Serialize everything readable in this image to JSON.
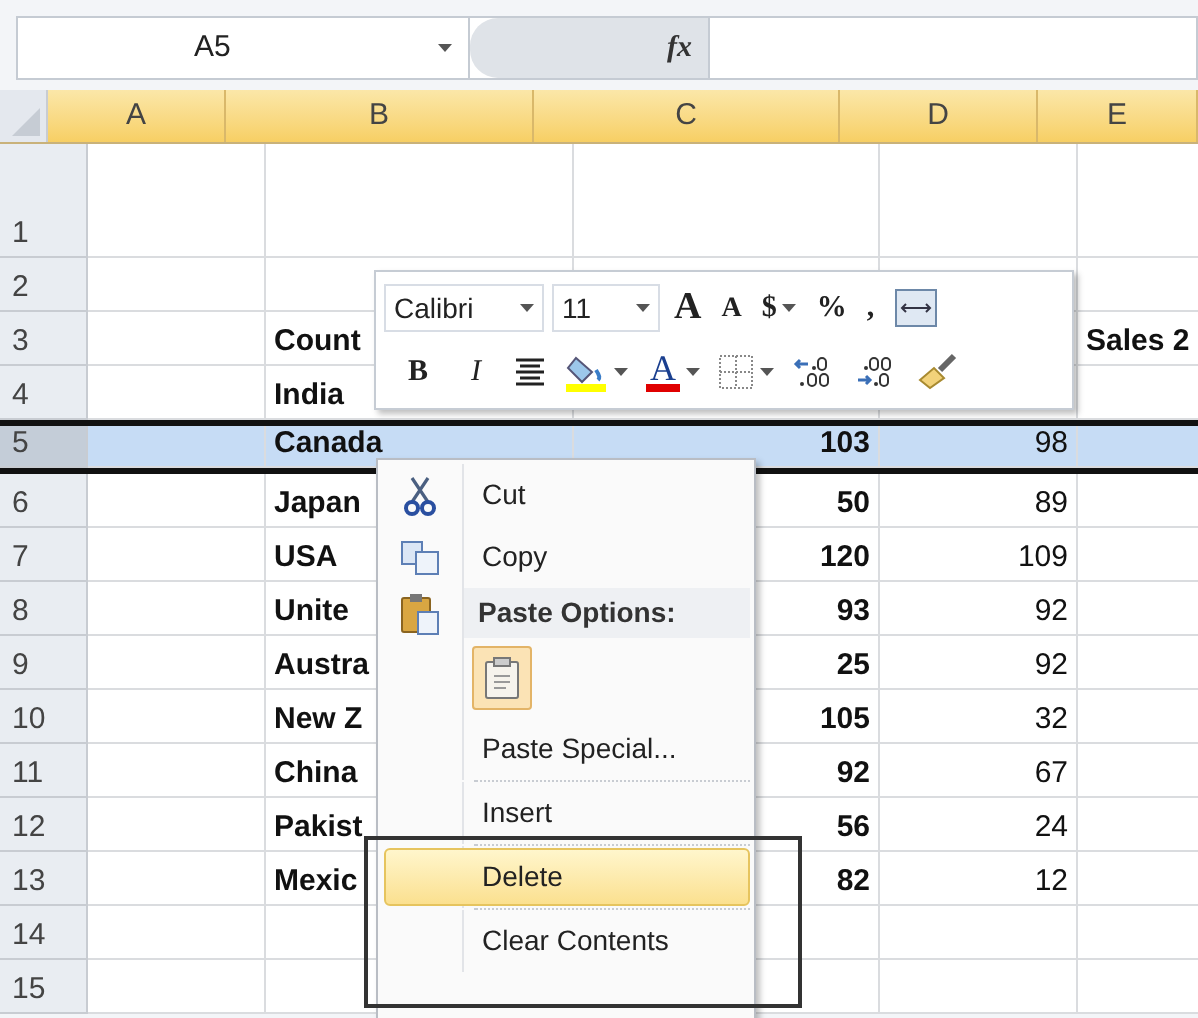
{
  "formula_bar": {
    "name_box": "A5",
    "function_label": "fx"
  },
  "columns": [
    {
      "label": "A"
    },
    {
      "label": "B"
    },
    {
      "label": "C"
    },
    {
      "label": "D"
    },
    {
      "label": "E"
    }
  ],
  "rows": [
    {
      "header": "1",
      "selected": false,
      "cells": {}
    },
    {
      "header": "2",
      "selected": false,
      "cells": {}
    },
    {
      "header": "3",
      "selected": false,
      "cells": {
        "B": {
          "text": "Count",
          "kind": "text"
        },
        "E": {
          "text": "Sales 2",
          "kind": "text"
        }
      }
    },
    {
      "header": "4",
      "selected": false,
      "cells": {
        "B": {
          "text": "India",
          "kind": "text"
        }
      }
    },
    {
      "header": "5",
      "selected": true,
      "cells": {
        "B": {
          "text": "Canada",
          "kind": "text"
        },
        "C": {
          "text": "103",
          "kind": "number"
        },
        "D": {
          "text": "98",
          "kind": "plain_number"
        }
      }
    },
    {
      "header": "6",
      "selected": false,
      "cells": {
        "B": {
          "text": "Japan",
          "kind": "text"
        },
        "C": {
          "text": "50",
          "kind": "number"
        },
        "D": {
          "text": "89",
          "kind": "plain_number"
        }
      }
    },
    {
      "header": "7",
      "selected": false,
      "cells": {
        "B": {
          "text": "USA",
          "kind": "text"
        },
        "C": {
          "text": "120",
          "kind": "number"
        },
        "D": {
          "text": "109",
          "kind": "plain_number"
        }
      }
    },
    {
      "header": "8",
      "selected": false,
      "cells": {
        "B": {
          "text": "Unite",
          "kind": "text"
        },
        "C": {
          "text": "93",
          "kind": "number"
        },
        "D": {
          "text": "92",
          "kind": "plain_number"
        }
      }
    },
    {
      "header": "9",
      "selected": false,
      "cells": {
        "B": {
          "text": "Austra",
          "kind": "text"
        },
        "C": {
          "text": "25",
          "kind": "number"
        },
        "D": {
          "text": "92",
          "kind": "plain_number"
        }
      }
    },
    {
      "header": "10",
      "selected": false,
      "cells": {
        "B": {
          "text": "New Z",
          "kind": "text"
        },
        "C": {
          "text": "105",
          "kind": "number"
        },
        "D": {
          "text": "32",
          "kind": "plain_number"
        }
      }
    },
    {
      "header": "11",
      "selected": false,
      "cells": {
        "B": {
          "text": "China",
          "kind": "text"
        },
        "C": {
          "text": "92",
          "kind": "number"
        },
        "D": {
          "text": "67",
          "kind": "plain_number"
        }
      }
    },
    {
      "header": "12",
      "selected": false,
      "cells": {
        "B": {
          "text": "Pakist",
          "kind": "text"
        },
        "C": {
          "text": "56",
          "kind": "number"
        },
        "D": {
          "text": "24",
          "kind": "plain_number"
        }
      }
    },
    {
      "header": "13",
      "selected": false,
      "cells": {
        "B": {
          "text": "Mexic",
          "kind": "text"
        },
        "C": {
          "text": "82",
          "kind": "number"
        },
        "D": {
          "text": "12",
          "kind": "plain_number"
        }
      }
    },
    {
      "header": "14",
      "selected": false,
      "cells": {}
    },
    {
      "header": "15",
      "selected": false,
      "cells": {}
    }
  ],
  "mini_toolbar": {
    "rows": [
      [
        {
          "kind": "font",
          "label": "Calibri",
          "has_menu": true
        },
        {
          "kind": "size",
          "label": "11",
          "has_menu": true
        },
        {
          "kind": "grow",
          "label": "A"
        },
        {
          "kind": "shrink",
          "label": "A"
        },
        {
          "kind": "glyph",
          "label": "$",
          "has_menu": true
        },
        {
          "kind": "glyph",
          "label": "%"
        },
        {
          "kind": "glyph",
          "label": ","
        },
        {
          "kind": "wrap_text"
        }
      ],
      [
        {
          "kind": "bold",
          "label": "B"
        },
        {
          "kind": "italic",
          "label": "I"
        },
        {
          "kind": "align"
        },
        {
          "kind": "fill_color",
          "has_menu": true
        },
        {
          "kind": "font_color",
          "label": "A",
          "has_menu": true
        },
        {
          "kind": "borders",
          "has_menu": true
        },
        {
          "kind": "increase_decimal"
        },
        {
          "kind": "decrease_decimal"
        },
        {
          "kind": "format_painter"
        }
      ]
    ]
  },
  "context_menu": {
    "items": [
      {
        "kind": "command",
        "label": "Cut",
        "selected": false
      },
      {
        "kind": "command",
        "label": "Copy",
        "selected": false
      },
      {
        "kind": "header",
        "label": "Paste Options:"
      },
      {
        "kind": "paste_button"
      },
      {
        "kind": "command",
        "label": "Paste Special...",
        "selected": false
      },
      {
        "kind": "command",
        "label": "Insert",
        "selected": false
      },
      {
        "kind": "command",
        "label": "Delete",
        "selected": true
      },
      {
        "kind": "command",
        "label": "Clear Contents",
        "selected": false
      }
    ]
  },
  "annotation": {
    "kind": "rectangle"
  }
}
